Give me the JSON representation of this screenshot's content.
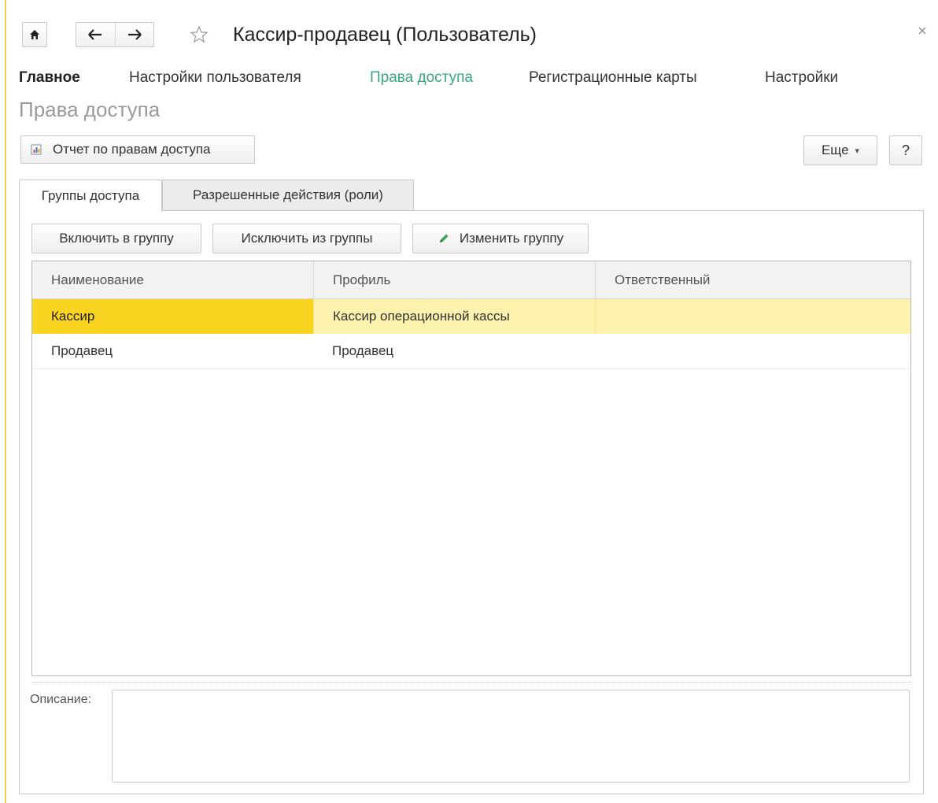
{
  "window": {
    "title": "Кассир-продавец (Пользователь)",
    "icons": {
      "home": "home-icon",
      "back": "arrow-left-icon",
      "forward": "arrow-right-icon",
      "favorite": "star-icon",
      "close": "close-icon"
    }
  },
  "sections": [
    {
      "label": "Главное",
      "state": "bold"
    },
    {
      "label": "Настройки пользователя",
      "state": "normal"
    },
    {
      "label": "Права доступа",
      "state": "active"
    },
    {
      "label": "Регистрационные карты",
      "state": "normal"
    },
    {
      "label": "Настройки",
      "state": "normal"
    }
  ],
  "page_title": "Права доступа",
  "toolbar": {
    "report_label": "Отчет по правам доступа",
    "more_label": "Еще",
    "help_label": "?"
  },
  "tabs": [
    {
      "label": "Группы доступа",
      "selected": true
    },
    {
      "label": "Разрешенные действия (роли)",
      "selected": false
    }
  ],
  "group_actions": {
    "include": "Включить в группу",
    "exclude": "Исключить из группы",
    "edit": "Изменить группу"
  },
  "table": {
    "columns": [
      "Наименование",
      "Профиль",
      "Ответственный"
    ],
    "rows": [
      {
        "name": "Кассир",
        "profile": "Кассир операционной кассы",
        "responsible": "",
        "selected": true
      },
      {
        "name": "Продавец",
        "profile": "Продавец",
        "responsible": "",
        "selected": false
      }
    ]
  },
  "description": {
    "label": "Описание:",
    "value": ""
  },
  "colors": {
    "accent_green": "#3aa77a",
    "selected_cell": "#f9d420",
    "selected_row": "#fcf1ad",
    "left_accent": "#f0d14a"
  }
}
